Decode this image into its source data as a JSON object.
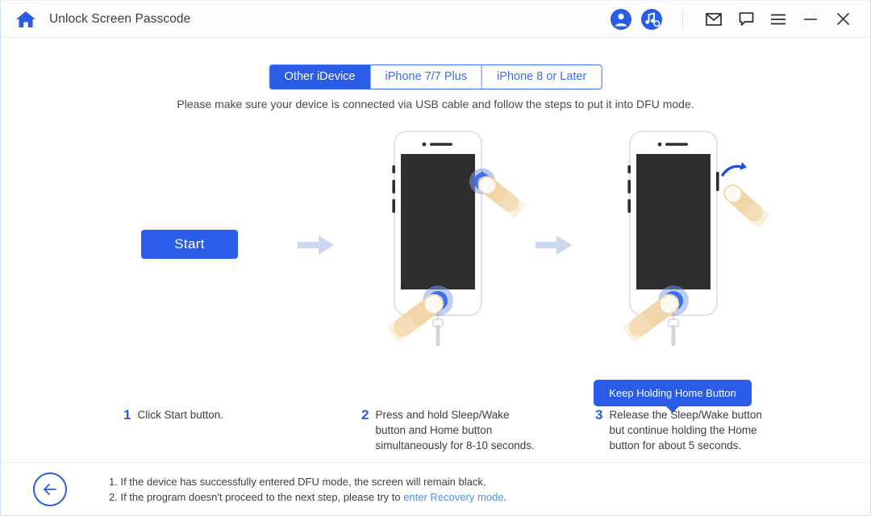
{
  "titlebar": {
    "home_icon": "home-icon",
    "title": "Unlock Screen Passcode",
    "icons": [
      {
        "name": "account-icon",
        "label": "Account"
      },
      {
        "name": "music-search-icon",
        "label": "Music Search"
      },
      {
        "name": "mail-icon",
        "label": "Mail"
      },
      {
        "name": "feedback-icon",
        "label": "Feedback"
      },
      {
        "name": "menu-icon",
        "label": "Menu"
      },
      {
        "name": "minimize-icon",
        "label": "Minimize"
      },
      {
        "name": "close-icon",
        "label": "Close"
      }
    ]
  },
  "tabs": [
    {
      "label": "Other iDevice",
      "active": true
    },
    {
      "label": "iPhone 7/7 Plus",
      "active": false
    },
    {
      "label": "iPhone 8 or Later",
      "active": false
    }
  ],
  "lead_text": "Please make sure your device is connected via USB cable and follow the steps to put it into DFU mode.",
  "start_button": "Start",
  "tooltip": "Keep Holding Home Button",
  "steps": [
    {
      "number": "1",
      "text": "Click Start button."
    },
    {
      "number": "2",
      "text": "Press and hold Sleep/Wake\nbutton and Home button\nsimultaneously for 8-10 seconds."
    },
    {
      "number": "3",
      "text": "Release the Sleep/Wake button\nbut continue holding the Home\nbutton for about 5 seconds."
    }
  ],
  "footer": {
    "back_icon": "back-arrow-icon",
    "note_1": "1. If the device has successfully entered DFU mode, the screen will remain black.",
    "note_2_prefix": "2. If the program doesn't proceed to the next step, please try to ",
    "note_2_link": "enter Recovery mode",
    "note_2_suffix": "."
  },
  "colors": {
    "accent": "#2b5ce8",
    "tab_border": "#3b6ef0",
    "link": "#4a90e2",
    "arrow": "#ccd8f0",
    "screen": "#2e2e2e",
    "finger": "#f2d5a8"
  }
}
